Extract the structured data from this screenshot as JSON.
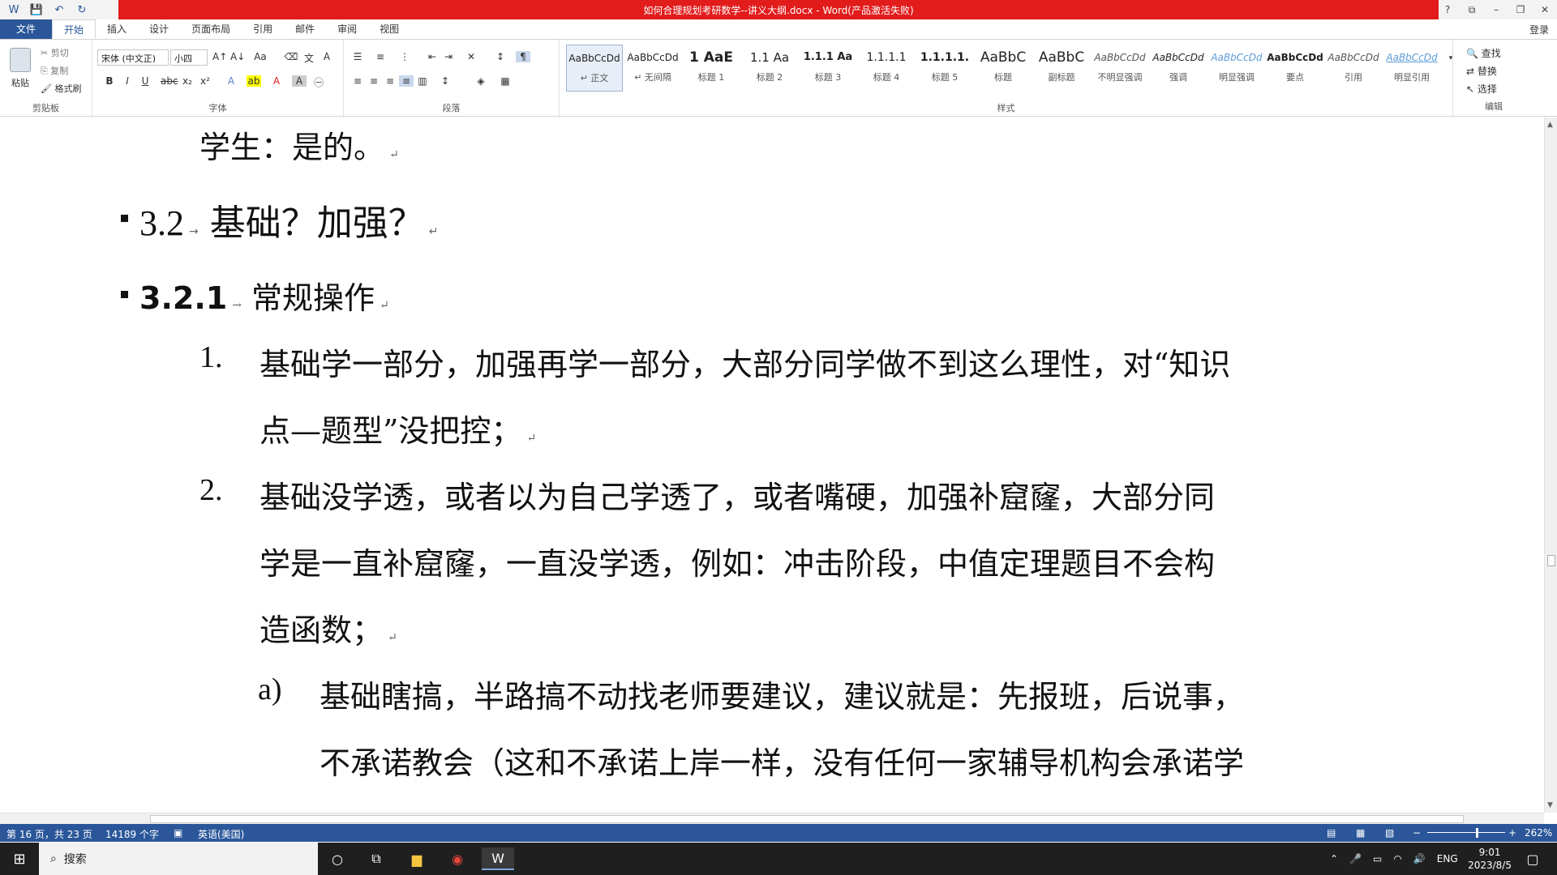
{
  "window": {
    "title": "如何合理规划考研数学--讲义大纲.docx - Word(产品激活失败)",
    "controls": [
      "?",
      "⧉",
      "–",
      "❐",
      "✕"
    ]
  },
  "tabs": [
    {
      "label": "文件"
    },
    {
      "label": "开始"
    },
    {
      "label": "插入"
    },
    {
      "label": "设计"
    },
    {
      "label": "页面布局"
    },
    {
      "label": "引用"
    },
    {
      "label": "邮件"
    },
    {
      "label": "审阅"
    },
    {
      "label": "视图"
    }
  ],
  "login": "登录",
  "ribbon": {
    "clipboard": {
      "paste": "粘贴",
      "cut": "剪切",
      "copy": "复制",
      "format_painter": "格式刷",
      "label": "剪贴板"
    },
    "font": {
      "name": "宋体 (中文正)",
      "size": "小四",
      "label": "字体"
    },
    "paragraph": {
      "label": "段落"
    },
    "styles": {
      "label": "样式",
      "items": [
        {
          "sample": "AaBbCcDd",
          "name": "↵ 正文"
        },
        {
          "sample": "AaBbCcDd",
          "name": "↵ 无间隔"
        },
        {
          "sample": "1 AaE",
          "name": "标题 1"
        },
        {
          "sample": "1.1 Aa",
          "name": "标题 2"
        },
        {
          "sample": "1.1.1 Aa",
          "name": "标题 3"
        },
        {
          "sample": "1.1.1.1",
          "name": "标题 4"
        },
        {
          "sample": "1.1.1.1.",
          "name": "标题 5"
        },
        {
          "sample": "AaBbC",
          "name": "标题"
        },
        {
          "sample": "AaBbC",
          "name": "副标题"
        },
        {
          "sample": "AaBbCcDd",
          "name": "不明显强调"
        },
        {
          "sample": "AaBbCcDd",
          "name": "强调"
        },
        {
          "sample": "AaBbCcDd",
          "name": "明显强调"
        },
        {
          "sample": "AaBbCcDd",
          "name": "要点"
        },
        {
          "sample": "AaBbCcDd",
          "name": "引用"
        },
        {
          "sample": "AaBbCcDd",
          "name": "明显引用"
        }
      ]
    },
    "editing": {
      "find": "查找",
      "replace": "替换",
      "select": "选择",
      "label": "编辑"
    }
  },
  "document": {
    "line_student": "学生：是的。",
    "h2_num": "3.2",
    "h2_text": "基础？加强？",
    "h3_num": "3.2.1",
    "h3_text": "常规操作",
    "item1_num": "1.",
    "item1_l1": "基础学一部分，加强再学一部分，大部分同学做不到这么理性，对“知识",
    "item1_l2": "点—题型”没把控；",
    "item2_num": "2.",
    "item2_l1": "基础没学透，或者以为自己学透了，或者嘴硬，加强补窟窿，大部分同",
    "item2_l2": "学是一直补窟窿，一直没学透，例如：冲击阶段，中值定理题目不会构",
    "item2_l3": "造函数；",
    "sub_a_num": "a)",
    "sub_a_l1": "基础瞎搞，半路搞不动找老师要建议，建议就是：先报班，后说事，",
    "sub_a_l2": "不承诺教会（这和不承诺上岸一样，没有任何一家辅导机构会承诺学"
  },
  "status": {
    "page": "第 16 页，共 23 页",
    "words": "14189 个字",
    "lang": "英语(美国)",
    "zoom": "262%"
  },
  "taskbar": {
    "search": "搜索",
    "lang": "ENG",
    "time": "9:01",
    "date": "2023/8/5"
  }
}
